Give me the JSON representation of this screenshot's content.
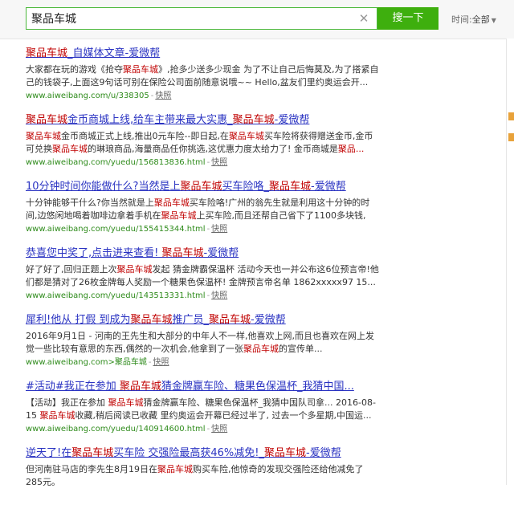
{
  "search": {
    "query": "聚品车城",
    "button_label": "搜一下",
    "time_label": "时间:",
    "time_value": "全部"
  },
  "results": [
    {
      "title": [
        {
          "t": "聚品车城",
          "h": true
        },
        {
          "t": "_自媒体文章-爱微帮",
          "h": false
        }
      ],
      "snippet": [
        {
          "t": "大家都在玩的游戏《抢夺",
          "h": false
        },
        {
          "t": "聚品车城",
          "h": true
        },
        {
          "t": "》,抢多少送多少现金 为了不让自己后悔莫及,为了搭紧自己的钱袋子,上面这9句话可别在保险公司面前随意说哦~~ Hello,盆友们里约奥运会开...",
          "h": false
        }
      ],
      "url": "www.aiweibang.com/u/338305",
      "cache": "快照"
    },
    {
      "title": [
        {
          "t": "聚品车城",
          "h": true
        },
        {
          "t": "金币商城上线,给车主带来最大实惠_",
          "h": false
        },
        {
          "t": "聚品车城",
          "h": true
        },
        {
          "t": "-爱微帮",
          "h": false
        }
      ],
      "snippet": [
        {
          "t": "聚品车城",
          "h": true
        },
        {
          "t": "金币商城正式上线,推出0元车险--即日起,在",
          "h": false
        },
        {
          "t": "聚品车城",
          "h": true
        },
        {
          "t": "买车险将获得赠送金币,金币可兑换",
          "h": false
        },
        {
          "t": "聚品车城",
          "h": true
        },
        {
          "t": "的琳琅商品,海量商品任你挑选,这优惠力度太给力了! 金币商城是",
          "h": false
        },
        {
          "t": "聚品...",
          "h": true
        }
      ],
      "url": "www.aiweibang.com/yuedu/156813836.html",
      "cache": "快照"
    },
    {
      "title": [
        {
          "t": "10分钟时间你能做什么?当然是上",
          "h": false
        },
        {
          "t": "聚品车城",
          "h": true
        },
        {
          "t": "买车险咯_",
          "h": false
        },
        {
          "t": "聚品车城",
          "h": true
        },
        {
          "t": "-爱微帮",
          "h": false
        }
      ],
      "snippet": [
        {
          "t": "十分钟能够干什么?你当然就是上",
          "h": false
        },
        {
          "t": "聚品车城",
          "h": true
        },
        {
          "t": "买车险咯!广州的翁先生就是利用这十分钟的时间,边悠闲地喝着咖啡边拿着手机在",
          "h": false
        },
        {
          "t": "聚品车城",
          "h": true
        },
        {
          "t": "上买车险,而且还帮自己省下了1100多块钱,这...",
          "h": false
        }
      ],
      "url": "www.aiweibang.com/yuedu/155415344.html",
      "cache": "快照"
    },
    {
      "title": [
        {
          "t": "恭喜您中奖了,点击进来查看! ",
          "h": false
        },
        {
          "t": "聚品车城",
          "h": true
        },
        {
          "t": "-爱微帮",
          "h": false
        }
      ],
      "snippet": [
        {
          "t": "好了好了,回归正题上次",
          "h": false
        },
        {
          "t": "聚品车城",
          "h": true
        },
        {
          "t": "发起 猜金牌霸保温杯 活动今天也一并公布这6位预言帝!他们都是猜对了26枚金牌每人奖励一个糖果色保温杯! 金牌预言帝名单 1862xxxxx97 15...",
          "h": false
        }
      ],
      "url": "www.aiweibang.com/yuedu/143513331.html",
      "cache": "快照"
    },
    {
      "title": [
        {
          "t": "犀利!他从 打假 到成为",
          "h": false
        },
        {
          "t": "聚品车城",
          "h": true
        },
        {
          "t": "推广员_",
          "h": false
        },
        {
          "t": "聚品车城",
          "h": true
        },
        {
          "t": "-爱微帮",
          "h": false
        }
      ],
      "snippet": [
        {
          "t": "2016年9月1日 - 河南的王先生和大部分的中年人不一样,他喜欢上网,而且也喜欢在网上发觉一些比较有意思的东西,偶然的一次机会,他拿到了一张",
          "h": false
        },
        {
          "t": "聚品车城",
          "h": true
        },
        {
          "t": "的宣传单...",
          "h": false
        }
      ],
      "url": "www.aiweibang.com>聚品车城",
      "cache": "快照"
    },
    {
      "title": [
        {
          "t": "#活动#我正在参加 ",
          "h": false
        },
        {
          "t": "聚品车城",
          "h": true
        },
        {
          "t": "猜金牌赢车险、糖果色保温杯_我猜中国...",
          "h": false
        }
      ],
      "snippet": [
        {
          "t": "【活动】我正在参加 ",
          "h": false
        },
        {
          "t": "聚品车城",
          "h": true
        },
        {
          "t": "猜金牌赢车险、糖果色保温杯_我猜中国队司拿... 2016-08-15 ",
          "h": false
        },
        {
          "t": "聚品车城",
          "h": true
        },
        {
          "t": "收藏,稍后阅读已收藏 里约奥运会开幕已经过半了, 过去一个多星期,中国运...",
          "h": false
        }
      ],
      "url": "www.aiweibang.com/yuedu/140914600.html",
      "cache": "快照"
    },
    {
      "title": [
        {
          "t": "逆天了!在",
          "h": false
        },
        {
          "t": "聚品车城",
          "h": true
        },
        {
          "t": "买车险 交强险最高获46%减免!_",
          "h": false
        },
        {
          "t": "聚品车城",
          "h": true
        },
        {
          "t": "-爱微帮",
          "h": false
        }
      ],
      "snippet": [
        {
          "t": "但河南驻马店的李先生8月19日在",
          "h": false
        },
        {
          "t": "聚品车城",
          "h": true
        },
        {
          "t": "购买车险,他惊奇的发现交强险还给他减免了285元。",
          "h": false
        }
      ],
      "url": "",
      "cache": ""
    }
  ],
  "colors": {
    "accent": "#3eaf0e",
    "link": "#2a33c2",
    "highlight": "#c00000",
    "url": "#2e8b1b"
  }
}
